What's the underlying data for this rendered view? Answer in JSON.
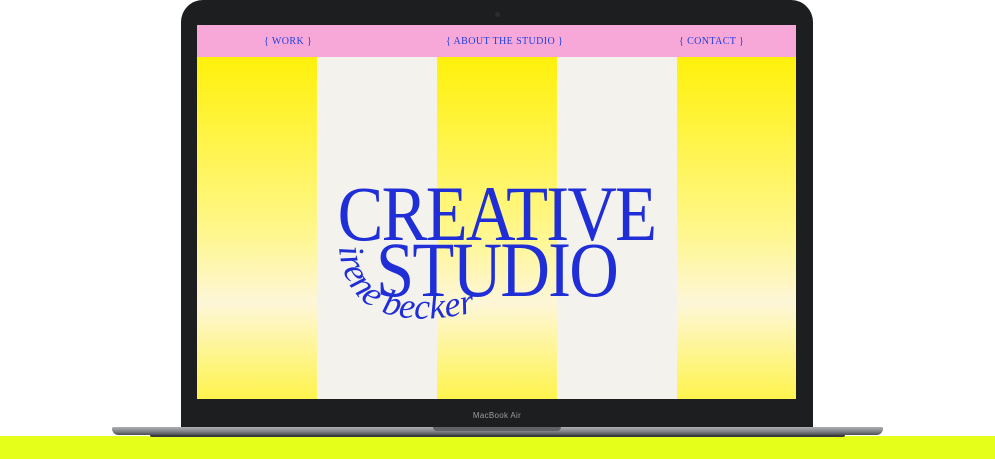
{
  "nav": {
    "work": "{ WORK }",
    "about": "{ ABOUT THE STUDIO }",
    "contact": "{ CONTACT }"
  },
  "hero": {
    "line1": "CREATIVE",
    "line2": "STUDIO",
    "script": "irene becker"
  },
  "device": {
    "model_label": "MacBook Air"
  },
  "colors": {
    "nav_background": "#f8a8d8",
    "text_blue": "#1f2ed6",
    "stripe_yellow": "#fff10a",
    "stripe_white": "#f3f2ec",
    "floor": "#e6ff1a"
  }
}
